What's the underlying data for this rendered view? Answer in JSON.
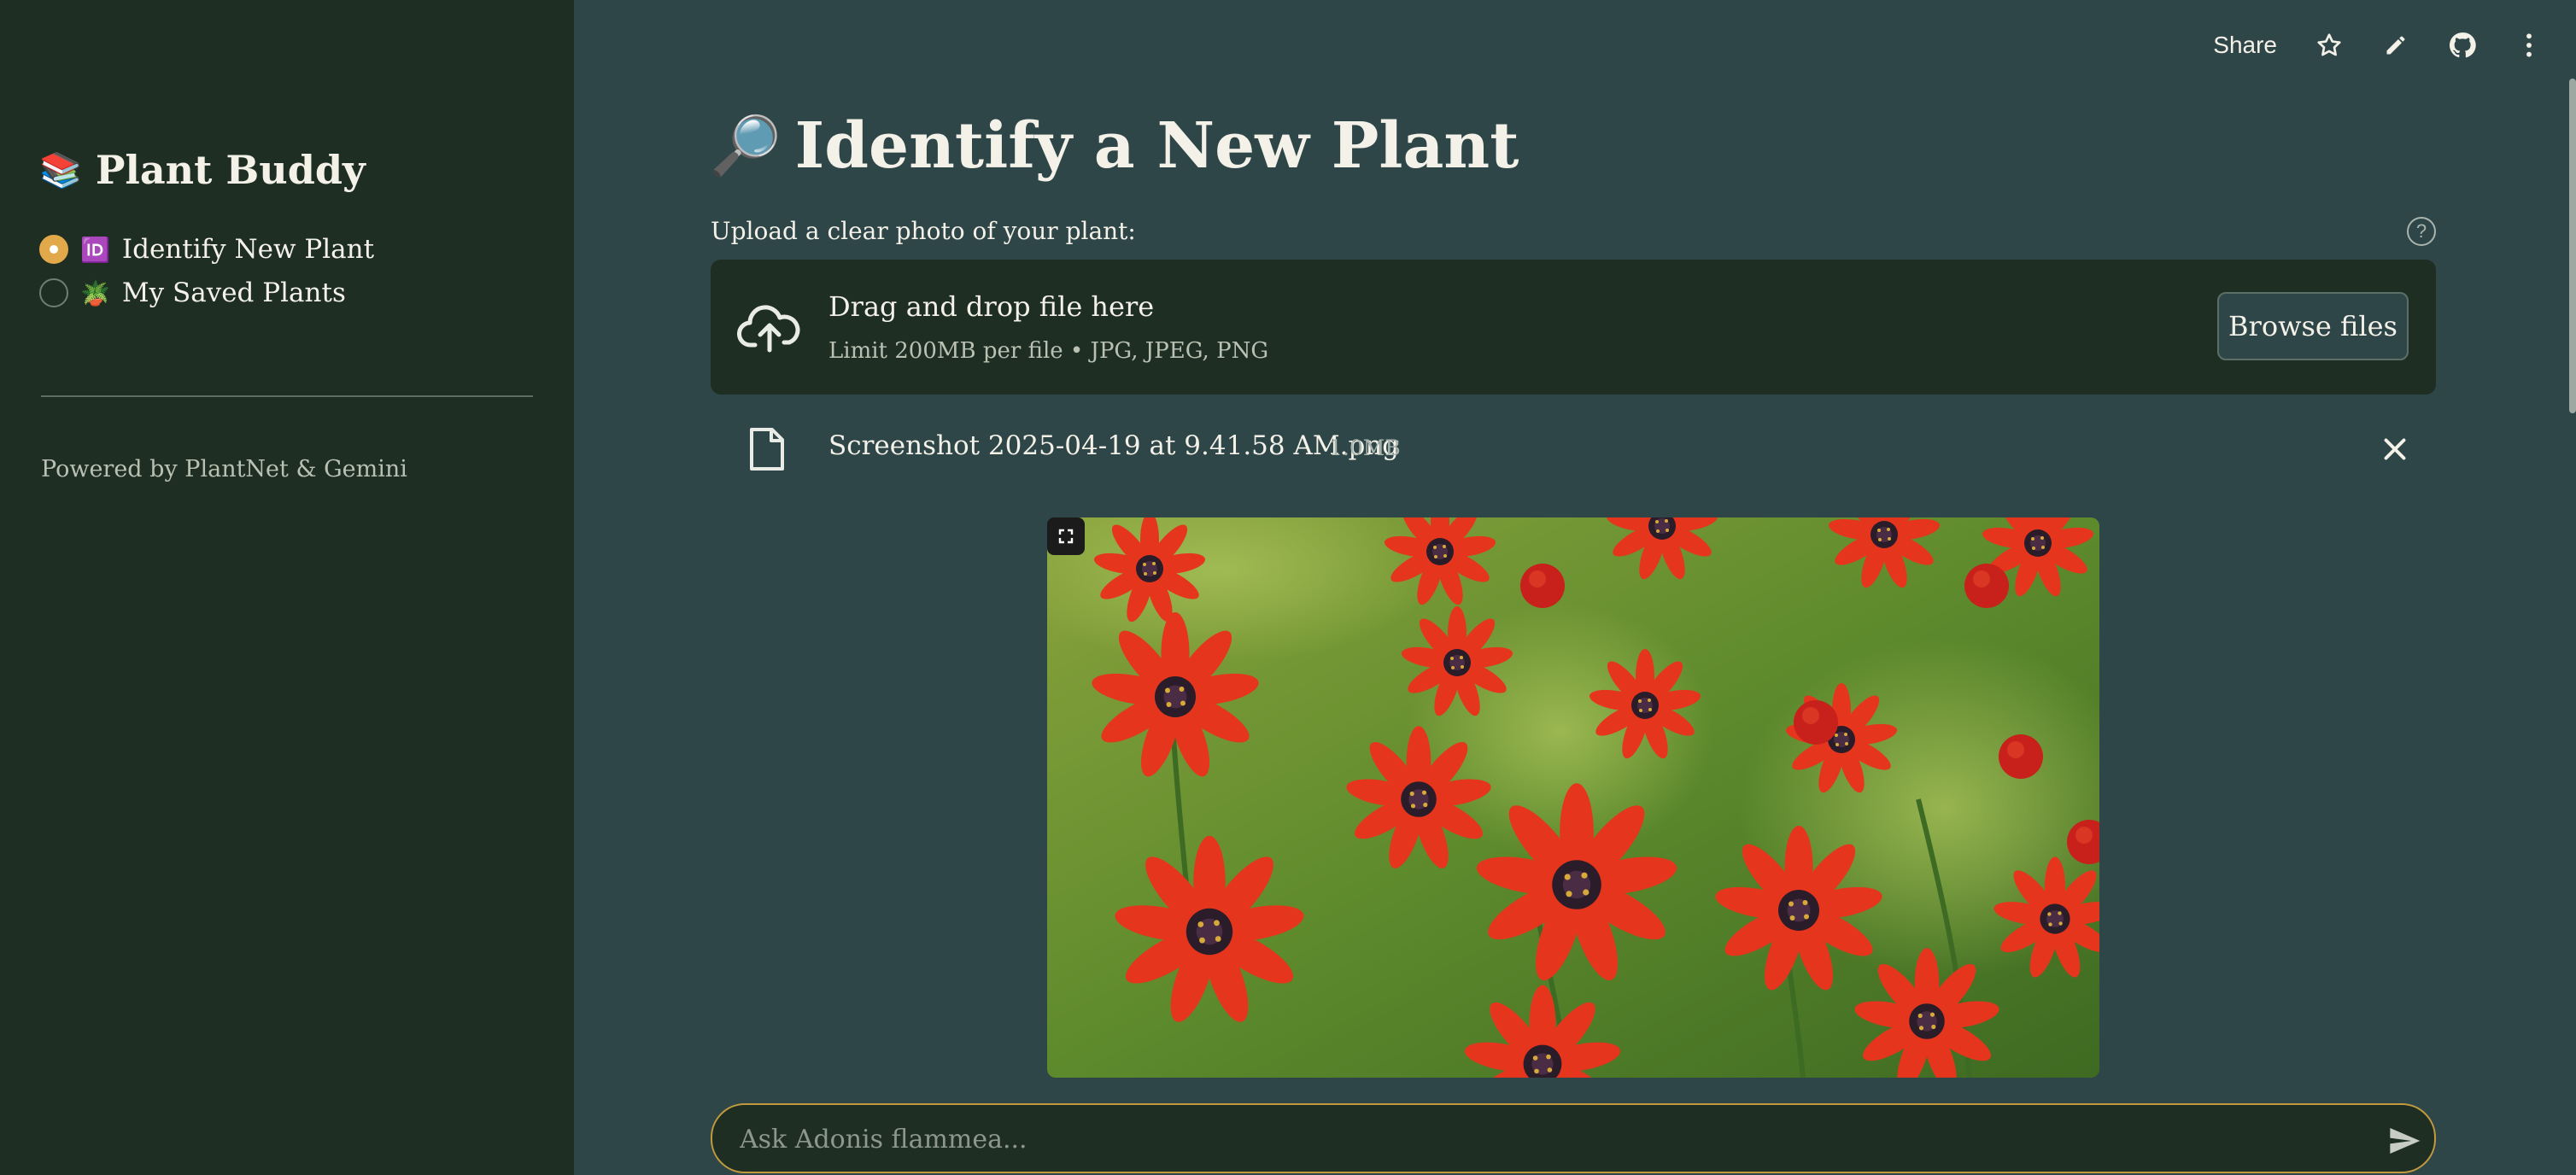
{
  "sidebar": {
    "brand": {
      "emoji": "📚",
      "title": "Plant Buddy"
    },
    "nav": [
      {
        "emoji": "🆔",
        "label": "Identify New Plant",
        "selected": true
      },
      {
        "emoji": "🪴",
        "label": "My Saved Plants",
        "selected": false
      }
    ],
    "footer": "Powered by PlantNet & Gemini"
  },
  "toolbar": {
    "share_label": "Share",
    "icons": [
      "star-icon",
      "pencil-icon",
      "github-icon",
      "more-vertical-icon"
    ]
  },
  "main": {
    "title_emoji": "🔎",
    "title": "Identify a New Plant",
    "upload_label": "Upload a clear photo of your plant:",
    "help_icon": "?",
    "dropzone": {
      "title": "Drag and drop file here",
      "limit": "Limit 200MB per file • JPG, JPEG, PNG",
      "browse_label": "Browse files"
    },
    "file": {
      "name": "Screenshot 2025-04-19 at 9.41.58 AM.png",
      "size": "1.0MB"
    },
    "image_alt": "Red Adonis flowers"
  },
  "chat": {
    "placeholder": "Ask Adonis flammea..."
  },
  "colors": {
    "sidebar_bg": "#1f2e22",
    "main_bg": "#2f4649",
    "accent": "#e2a94a",
    "input_border": "#c29a3e"
  }
}
